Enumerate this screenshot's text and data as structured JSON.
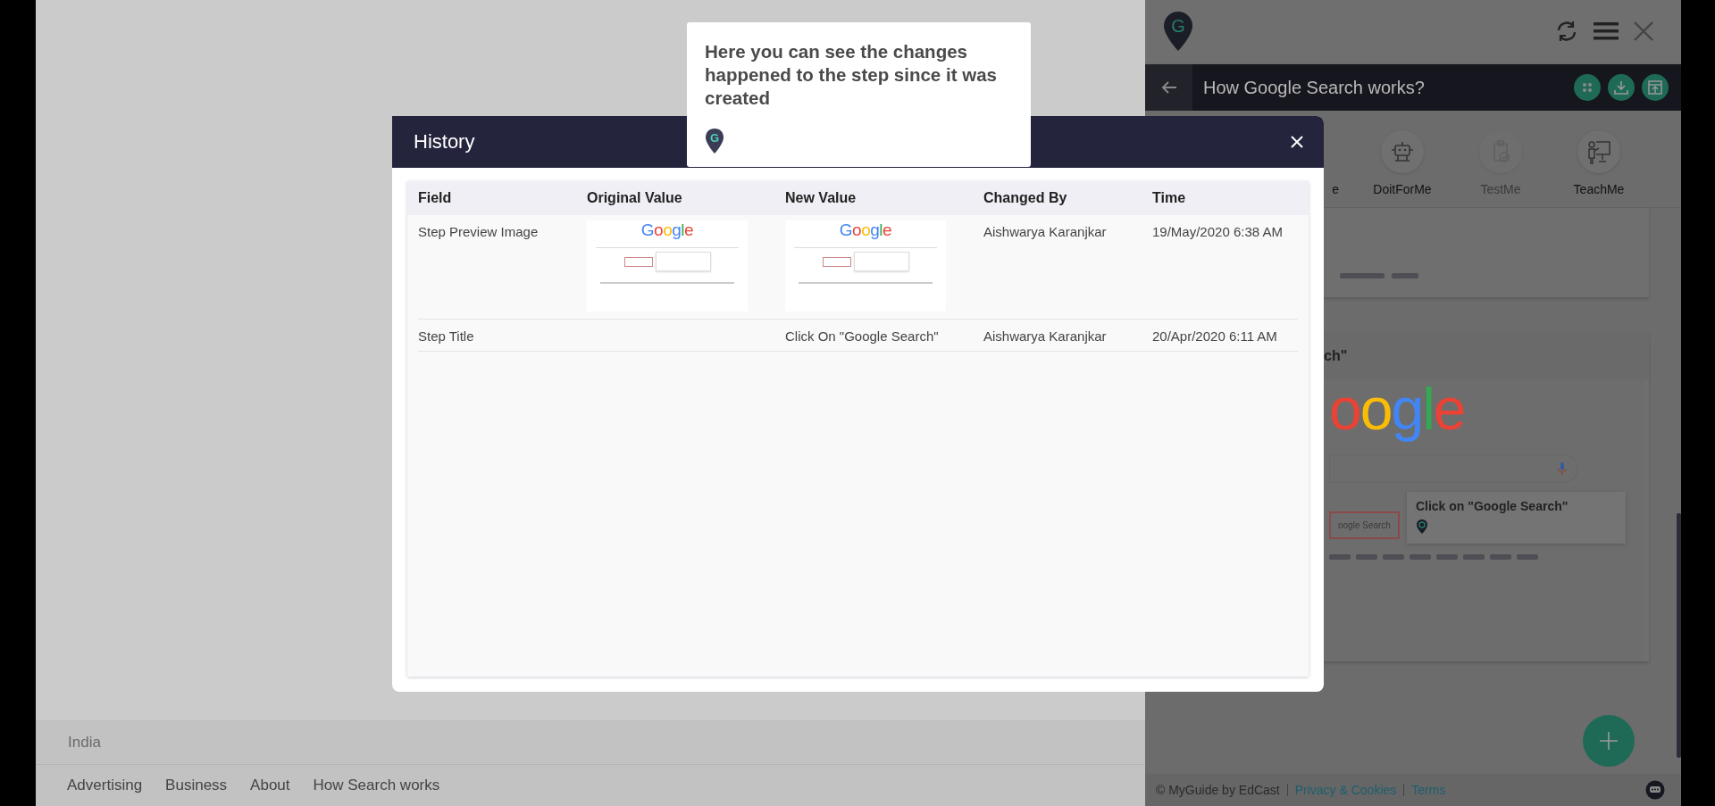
{
  "left_page": {
    "country": "India",
    "links": [
      "Advertising",
      "Business",
      "About",
      "How Search works"
    ]
  },
  "panel": {
    "logo_letter": "G",
    "title": "How Google Search works?",
    "tabs": [
      {
        "label": "e",
        "kind": "clipped",
        "disabled": false
      },
      {
        "label": "DoitForMe",
        "kind": "full",
        "disabled": false
      },
      {
        "label": "TestMe",
        "kind": "full",
        "disabled": true
      },
      {
        "label": "TeachMe",
        "kind": "full",
        "disabled": false
      }
    ],
    "step_card": {
      "title": "ch\"",
      "preview": {
        "logo": "oogle",
        "button": "oogle Search",
        "callout": "Click on \"Google Search\""
      }
    },
    "footer": {
      "copyright": "© MyGuide by EdCast",
      "links": [
        "Privacy & Cookies",
        "Terms"
      ]
    }
  },
  "dialog": {
    "title": "History",
    "columns": [
      "Field",
      "Original Value",
      "New Value",
      "Changed By",
      "Time"
    ],
    "rows": [
      {
        "field": "Step Preview Image",
        "original": {
          "kind": "image",
          "logo": "Google"
        },
        "new": {
          "kind": "image",
          "logo": "Google"
        },
        "changed_by": "Aishwarya Karanjkar",
        "time": "19/May/2020 6:38 AM"
      },
      {
        "field": "Step Title",
        "original": {
          "kind": "none"
        },
        "new": {
          "kind": "text",
          "text": "Click On \"Google Search\""
        },
        "changed_by": "Aishwarya Karanjkar",
        "time": "20/Apr/2020 6:11 AM"
      }
    ]
  },
  "tooltip": {
    "logo_letter": "G",
    "text": "Here you can see the changes happened to the step since it was created"
  }
}
